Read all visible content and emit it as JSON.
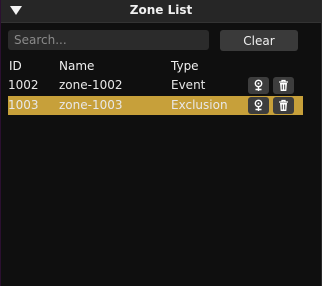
{
  "panel": {
    "title": "Zone List"
  },
  "search": {
    "placeholder": "Search..."
  },
  "toolbar": {
    "clear_label": "Clear"
  },
  "columns": {
    "id": "ID",
    "name": "Name",
    "type": "Type"
  },
  "rows": [
    {
      "id": "1002",
      "name": "zone-1002",
      "type": "Event",
      "selected": false
    },
    {
      "id": "1003",
      "name": "zone-1003",
      "type": "Exclusion",
      "selected": true
    }
  ],
  "icons": {
    "collapse": "triangle-down-icon",
    "locate": "map-pin-icon",
    "delete": "trash-icon"
  },
  "colors": {
    "selected_row": "#c7a03a",
    "background": "#0f0f0f",
    "titlebar": "#262626"
  }
}
